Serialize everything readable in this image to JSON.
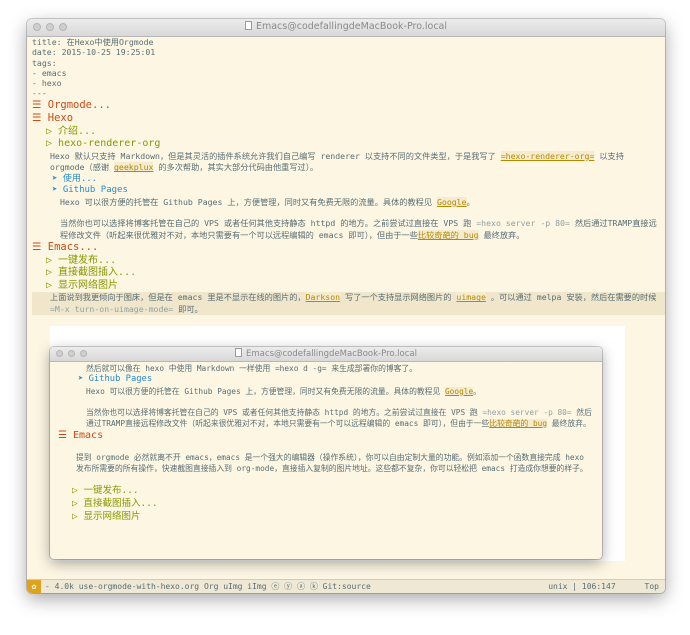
{
  "window": {
    "title": "Emacs@codefallingdeMacBook-Pro.local"
  },
  "frontmatter": [
    "title: 在Hexo中使用Orgmode",
    "date: 2015-10-25 19:25:01",
    "tags:",
    "- emacs",
    "- hexo",
    "---"
  ],
  "outline": {
    "orgmode": "Orgmode...",
    "hexo": "Hexo",
    "hexo_intro": "介绍...",
    "hexo_renderer": "hexo-renderer-org",
    "hexo_para_1a": "Hexo 默认只支持 Markdown，但是其灵活的插件系统允许我们自己编写 renderer 以支持不同的文件类型，于是我写了 ",
    "hexo_para_1_link": "=hexo-renderer-org=",
    "hexo_para_1b": " 以支持 orgmode（感谢 ",
    "hexo_para_1_link2": "geekplux",
    "hexo_para_1c": " 的多次帮助，其实大部分代码由他重写过）。",
    "usage": "使用...",
    "github_pages": "Github Pages",
    "gh_para_a": "Hexo 可以很方便的托管在 Github Pages 上，方便管理，同时又有免费无限的流量。具体的教程见 ",
    "gh_para_link": "Google",
    "gh_para_b": "。",
    "vps_para_a": "当然你也可以选择将博客托管在自己的 VPS 或者任何其他支持静态 httpd 的地方。之前尝试过直接在 VPS 跑 ",
    "vps_para_code": "=hexo server -p 80=",
    "vps_para_b": " 然后通过TRAMP直接远程修改文件（听起来很优雅对不对，本地只需要有一个可以远程编辑的 emacs 即可），但由于一些",
    "vps_para_link": "比较奇葩的 bug",
    "vps_para_c": " 最终放弃。",
    "emacs": "Emacs...",
    "publish": "一键发布...",
    "screenshot": "直接截图插入...",
    "show_images": "显示网络图片",
    "img_para_a": "上面说到我更倾向于图床，但是在 emacs 里是不显示在线的图片的，",
    "img_para_link1": "Darkson",
    "img_para_b": " 写了一个支持显示网络图片的 ",
    "img_para_link2": "uimage",
    "img_para_c": " 。可以通过 melpa 安装，然后在需要的时候 ",
    "img_para_code": "=M-x turn-on-uimage-mode=",
    "img_para_d": " 即可。"
  },
  "inner_window": {
    "title": "Emacs@codefallingdeMacBook-Pro.local",
    "line1": "然后就可以像在 hexo 中使用 Markdown 一样使用 =hexo d -g= 来生成部署你的博客了。",
    "github_pages": "Github Pages",
    "gh_para_a": "Hexo 可以很方便的托管在 Github Pages 上，方便管理，同时又有免费无限的流量。具体的教程见 ",
    "gh_para_link": "Google",
    "gh_para_b": "。",
    "vps_para_a": "当然你也可以选择将博客托管在自己的 VPS 或者任何其他支持静态 httpd 的地方。之前尝试过直接在 VPS 跑 ",
    "vps_para_code": "=hexo server -p 80=",
    "vps_para_b": " 然后通过TRAMP直接远程修改文件（听起来很优雅对不对，本地只需要有一个可以远程编辑的 emacs 即可），但由于一些",
    "vps_para_link": "比较奇葩的 bug",
    "vps_para_c": " 最终放弃。",
    "emacs": "Emacs",
    "emacs_para": "提到 orgmode 必然就离不开 emacs，emacs 是一个强大的编辑器（操作系统），你可以自由定制大量的功能。例如添加一个函数直接完成 hexo 发布所需要的所有操作，快速截图直接插入到 org-mode，直接插入复制的图片地址。这些都不复杂，你可以轻松把 emacs 打造成你想要的样子。",
    "publish": "一键发布...",
    "screenshot": "直接截图插入...",
    "show_images": "显示网络图片"
  },
  "modeline": {
    "left": "- 4.0k use-orgmode-with-hexo.org  Org   uImg iImg ⓔ ⓨ ⓐ ⓚ   Git:source",
    "position": "unix | 106:147",
    "scroll": "Top"
  },
  "colors": {
    "background": "#fdf6e3",
    "heading1": "#cb4b16",
    "heading2": "#859900",
    "heading3": "#268bd2",
    "link": "#b58900",
    "text": "#586e75"
  }
}
